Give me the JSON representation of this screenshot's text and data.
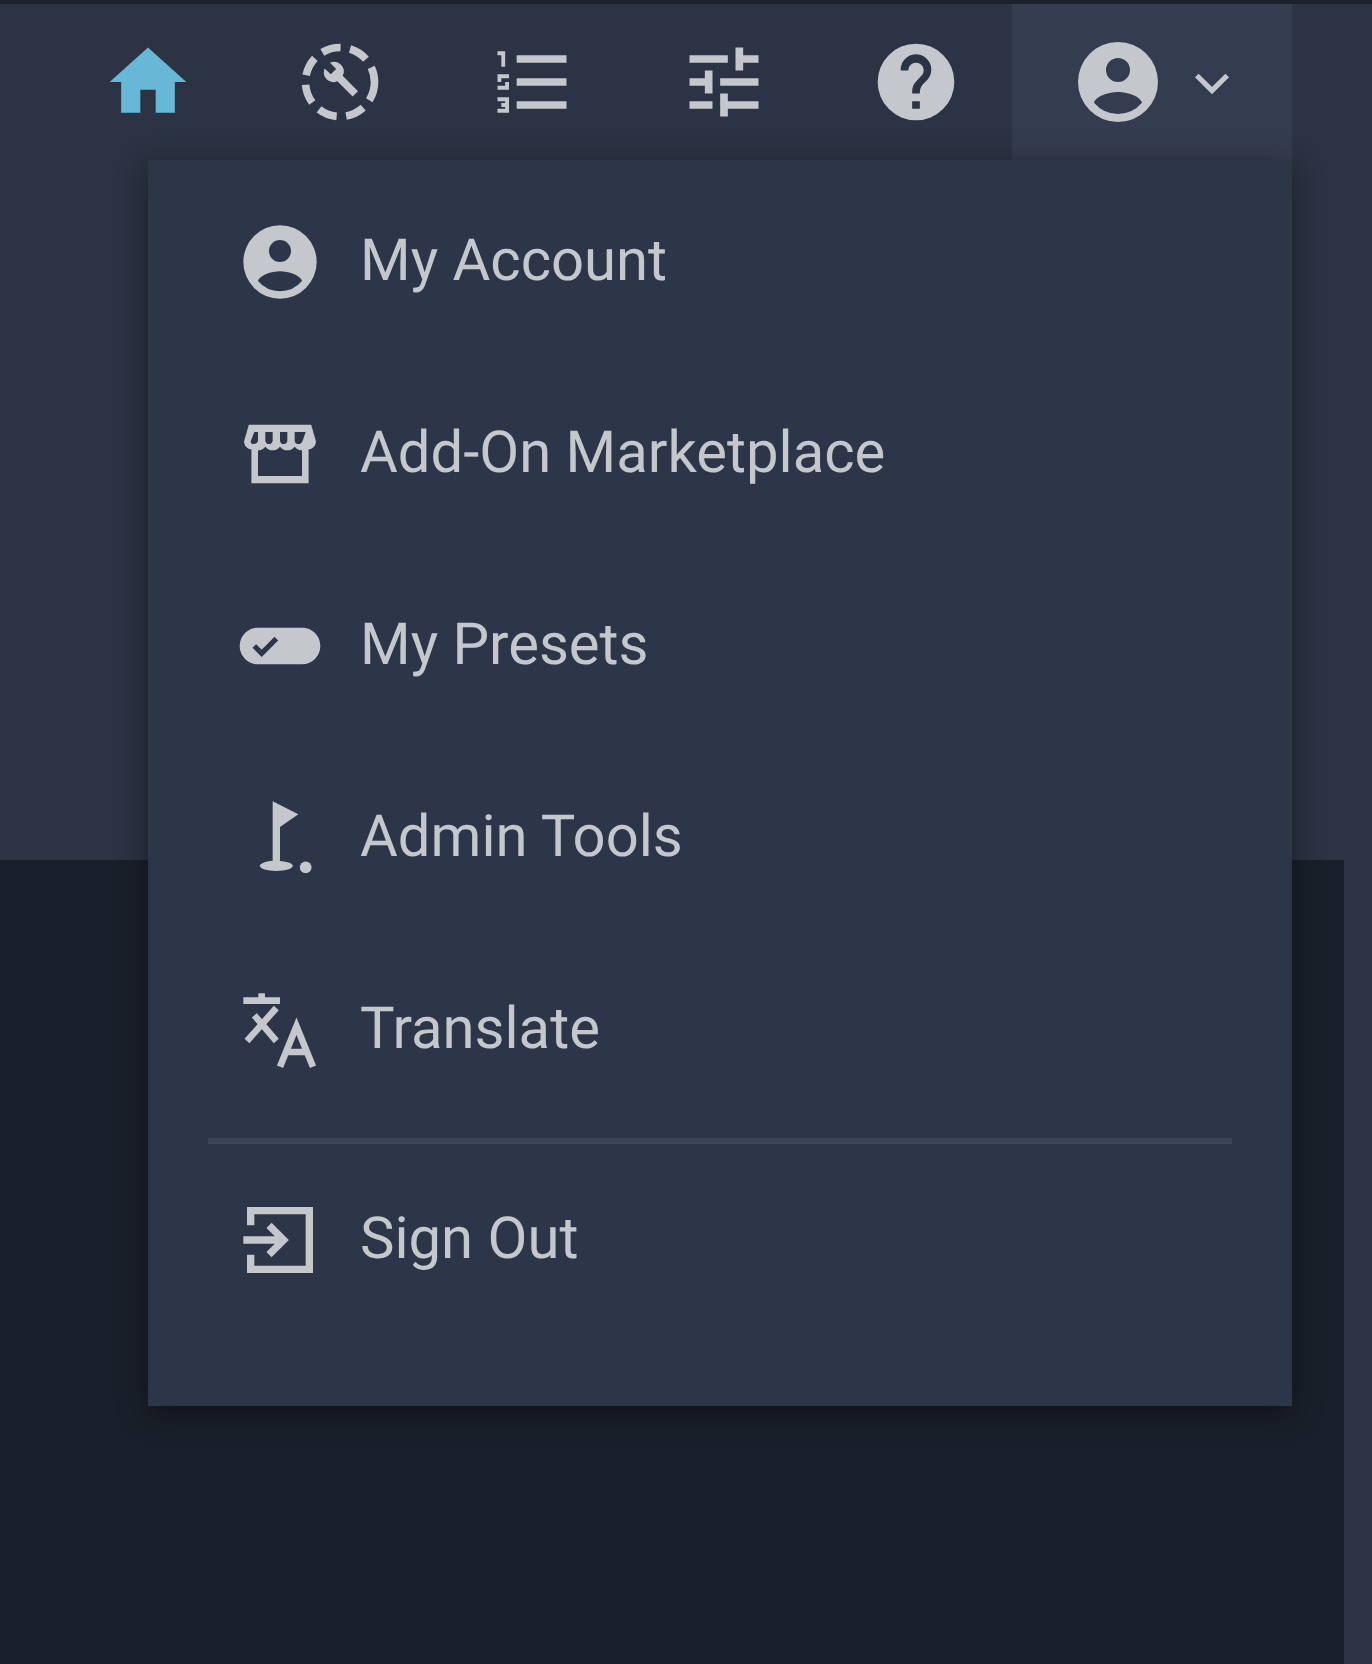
{
  "nav": [
    {
      "selected": true
    },
    {
      "selected": false
    },
    {
      "selected": false
    },
    {
      "selected": false
    },
    {
      "selected": false
    }
  ],
  "account_menu": {
    "expanded": true,
    "items": [
      {
        "label": "My Account"
      },
      {
        "label": "Add-On Marketplace"
      },
      {
        "label": "My Presets"
      },
      {
        "label": "Admin Tools"
      },
      {
        "label": "Translate"
      }
    ],
    "footer_items": [
      {
        "label": "Sign Out"
      }
    ]
  }
}
